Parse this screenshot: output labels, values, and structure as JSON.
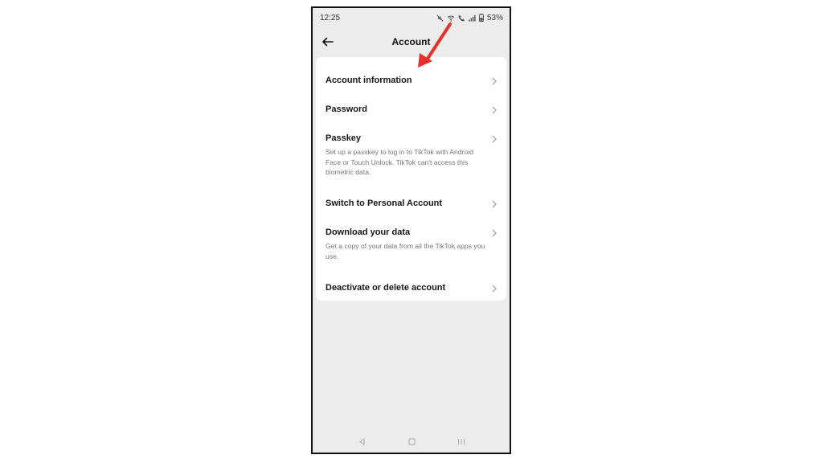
{
  "status_bar": {
    "time": "12:25",
    "battery": "53%"
  },
  "header": {
    "title": "Account",
    "back_icon": "arrow-left-icon"
  },
  "menu": {
    "items": [
      {
        "label": "Account information",
        "description": ""
      },
      {
        "label": "Password",
        "description": ""
      },
      {
        "label": "Passkey",
        "description": "Set up a passkey to log in to TikTok with Android Face or Touch Unlock. TikTok can't access this biometric data."
      },
      {
        "label": "Switch to Personal Account",
        "description": ""
      },
      {
        "label": "Download your data",
        "description": "Get a copy of your data from all the TikTok apps you use."
      },
      {
        "label": "Deactivate or delete account",
        "description": ""
      }
    ]
  },
  "nav_bar": {
    "icons": [
      "back-triangle-icon",
      "home-square-icon",
      "recents-icon"
    ]
  },
  "colors": {
    "background": "#ececec",
    "card": "#ffffff",
    "annotation_arrow": "#e8302a"
  }
}
